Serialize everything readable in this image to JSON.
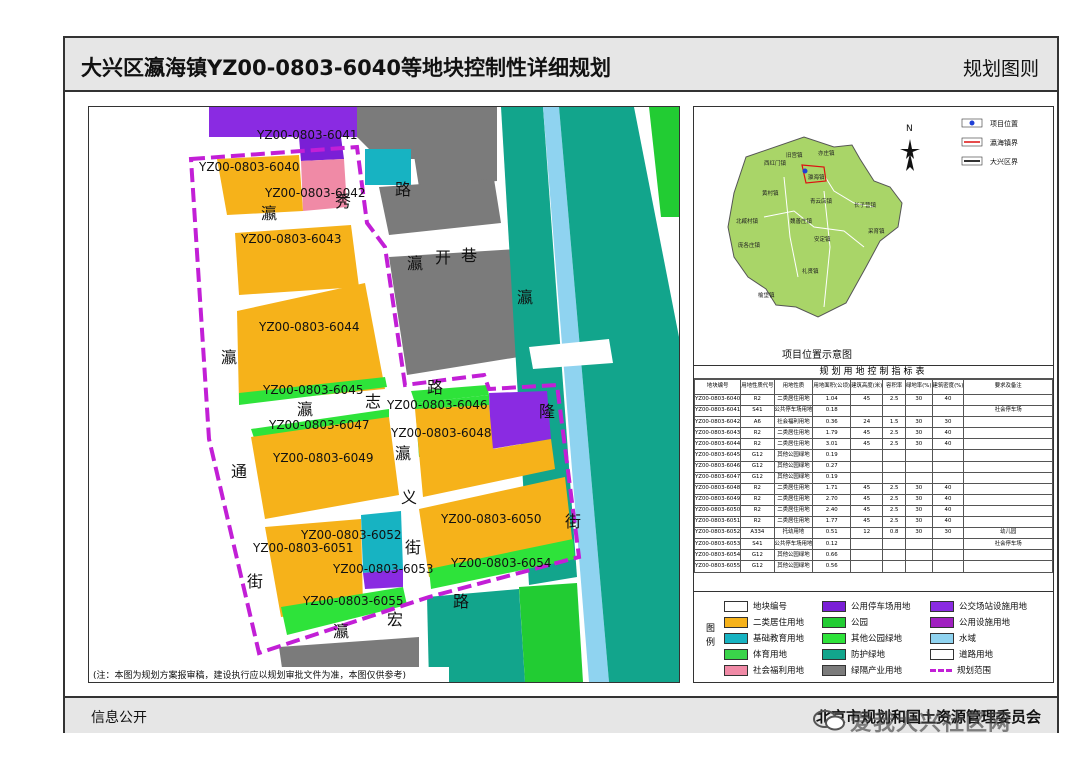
{
  "header": {
    "title": "大兴区瀛海镇YZ00-0803-6040等地块控制性详细规划",
    "sheet_name": "规划图则"
  },
  "footer": {
    "info_label": "信息公开",
    "agency": "北京市规划和国土资源管理委员会",
    "watermark": "爱我大兴社区网"
  },
  "map": {
    "note": "(注：本图为规划方案报审稿，建设执行应以规划审批文件为准，本图仅供参考)",
    "parcel_labels": [
      "YZ00-0803-6041",
      "YZ00-0803-6040",
      "YZ00-0803-6042",
      "YZ00-0803-6043",
      "YZ00-0803-6044",
      "YZ00-0803-6045",
      "YZ00-0803-6046",
      "YZ00-0803-6047",
      "YZ00-0803-6048",
      "YZ00-0803-6049",
      "YZ00-0803-6050",
      "YZ00-0803-6051",
      "YZ00-0803-6052",
      "YZ00-0803-6053",
      "YZ00-0803-6054",
      "YZ00-0803-6055"
    ],
    "road_chars": [
      "瀛",
      "秀",
      "路",
      "瀛",
      "开",
      "巷",
      "瀛",
      "瀛",
      "瀛",
      "志",
      "路",
      "隆",
      "瀛",
      "通",
      "义",
      "街",
      "街",
      "街",
      "宏",
      "路",
      "瀛",
      "街"
    ]
  },
  "inset": {
    "legend": [
      "项目位置",
      "瀛海镇界",
      "大兴区界"
    ],
    "north": "N",
    "caption": "项目位置示意图",
    "towns": [
      "西红门镇",
      "旧宫镇",
      "亦庄镇",
      "瀛海镇",
      "黄村镇",
      "北臧村镇",
      "魏善庄镇",
      "青云店镇",
      "长子营镇",
      "采育镇",
      "庞各庄镇",
      "安定镇",
      "礼贤镇",
      "榆垡镇"
    ]
  },
  "table": {
    "title": "规划用地控制指标表",
    "headers": [
      "地块编号",
      "用地性质代号",
      "用地性质",
      "用地面积(公顷)",
      "建筑高度(米)",
      "容积率",
      "绿地率(%)",
      "建筑密度(%)",
      "要求及备注"
    ],
    "rows": [
      [
        "YZ00-0803-6040",
        "R2",
        "二类居住用地",
        "1.04",
        "45",
        "2.5",
        "30",
        "40",
        ""
      ],
      [
        "YZ00-0803-6041",
        "S41",
        "公共停车场用地",
        "0.18",
        "",
        "",
        "",
        "",
        "社会停车场"
      ],
      [
        "YZ00-0803-6042",
        "A6",
        "社会福利用地",
        "0.36",
        "24",
        "1.5",
        "30",
        "30",
        ""
      ],
      [
        "YZ00-0803-6043",
        "R2",
        "二类居住用地",
        "1.79",
        "45",
        "2.5",
        "30",
        "40",
        ""
      ],
      [
        "YZ00-0803-6044",
        "R2",
        "二类居住用地",
        "3.01",
        "45",
        "2.5",
        "30",
        "40",
        ""
      ],
      [
        "YZ00-0803-6045",
        "G12",
        "其他公园绿地",
        "0.19",
        "",
        "",
        "",
        "",
        ""
      ],
      [
        "YZ00-0803-6046",
        "G12",
        "其他公园绿地",
        "0.27",
        "",
        "",
        "",
        "",
        ""
      ],
      [
        "YZ00-0803-6047",
        "G12",
        "其他公园绿地",
        "0.19",
        "",
        "",
        "",
        "",
        ""
      ],
      [
        "YZ00-0803-6048",
        "R2",
        "二类居住用地",
        "1.71",
        "45",
        "2.5",
        "30",
        "40",
        ""
      ],
      [
        "YZ00-0803-6049",
        "R2",
        "二类居住用地",
        "2.70",
        "45",
        "2.5",
        "30",
        "40",
        ""
      ],
      [
        "YZ00-0803-6050",
        "R2",
        "二类居住用地",
        "2.40",
        "45",
        "2.5",
        "30",
        "40",
        ""
      ],
      [
        "YZ00-0803-6051",
        "R2",
        "二类居住用地",
        "1.77",
        "45",
        "2.5",
        "30",
        "40",
        ""
      ],
      [
        "YZ00-0803-6052",
        "A334",
        "托幼用地",
        "0.51",
        "12",
        "0.8",
        "30",
        "30",
        "幼儿园"
      ],
      [
        "YZ00-0803-6053",
        "S41",
        "公共停车场用地",
        "0.12",
        "",
        "",
        "",
        "",
        "社会停车场"
      ],
      [
        "YZ00-0803-6054",
        "G12",
        "其他公园绿地",
        "0.66",
        "",
        "",
        "",
        "",
        ""
      ],
      [
        "YZ00-0803-6055",
        "G12",
        "其他公园绿地",
        "0.56",
        "",
        "",
        "",
        "",
        ""
      ]
    ]
  },
  "legend": {
    "title": "图例",
    "items": [
      {
        "label": "地块编号",
        "color": "#ffffff"
      },
      {
        "label": "公用停车场用地",
        "color": "#7a1fd6"
      },
      {
        "label": "公交场站设施用地",
        "color": "#8a2be2"
      },
      {
        "label": "二类居住用地",
        "color": "#f6b21a"
      },
      {
        "label": "公园",
        "color": "#22cc33"
      },
      {
        "label": "公用设施用地",
        "color": "#a020c0"
      },
      {
        "label": "基础教育用地",
        "color": "#17b3c2"
      },
      {
        "label": "其他公园绿地",
        "color": "#2ee33a"
      },
      {
        "label": "水域",
        "color": "#8fd3f0"
      },
      {
        "label": "体育用地",
        "color": "#3ad44a"
      },
      {
        "label": "防护绿地",
        "color": "#12a58c"
      },
      {
        "label": "道路用地",
        "color": "#ffffff"
      },
      {
        "label": "社会福利用地",
        "color": "#f08aa6"
      },
      {
        "label": "绿隔产业用地",
        "color": "#7b7b7b"
      },
      {
        "label": "规划范围",
        "color": "#c21fd6"
      }
    ]
  }
}
